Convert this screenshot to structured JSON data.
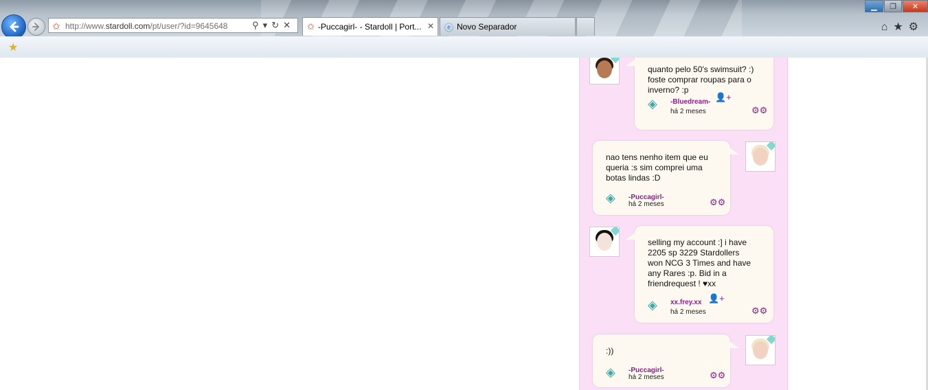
{
  "browser": {
    "url_prefix": "http://www.",
    "url_domain": "stardoll.com",
    "url_path": "/pt/user/?id=9645648",
    "tabs": [
      {
        "title": "-Puccagirl- - Stardoll | Port...",
        "active": true
      },
      {
        "title": "Novo Separador",
        "active": false
      }
    ],
    "window_controls": {
      "minimize": "▁",
      "maximize": "❐",
      "close": "✕"
    },
    "icons": [
      "back-arrow-icon",
      "forward-arrow-icon",
      "search-icon",
      "refresh-icon",
      "stop-icon",
      "home-icon",
      "star-icon",
      "gear-icon",
      "add-favorite-icon"
    ]
  },
  "comments": [
    {
      "side": "left",
      "text_lines": [
        "quanto pelo 50's swimsuit? :)",
        "foste comprar roupas para o",
        "inverno? :p"
      ],
      "author": "-Bluedream-",
      "time": "há 2 meses",
      "has_add_friend": true
    },
    {
      "side": "right",
      "text_lines": [
        "nao tens nenho item que eu",
        "queria :s sim comprei uma",
        "botas lindas :D"
      ],
      "author": "-Puccagirl-",
      "time": "há 2 meses",
      "has_add_friend": false
    },
    {
      "side": "left",
      "text_lines": [
        "selling my account :] i have",
        "2205 sp 3229 Stardollers",
        "won NCG 3 Times and have",
        "any Rares :p. Bid in a",
        "friendrequest ! ♥xx"
      ],
      "author": "xx.frey.xx",
      "time": "há 2 meses",
      "has_add_friend": true
    },
    {
      "side": "right",
      "text_lines": [
        ":))"
      ],
      "author": "-Puccagirl-",
      "time": "há 2 meses",
      "has_add_friend": false
    }
  ],
  "colors": {
    "wall_bg": "#fadff7",
    "bubble_bg": "#fdf8f0",
    "author": "#8b1e8b"
  }
}
